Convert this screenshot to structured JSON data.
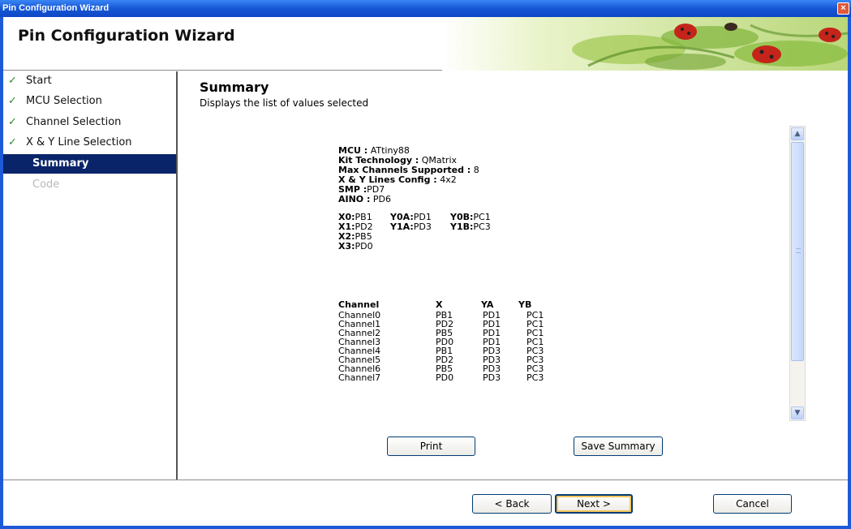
{
  "window": {
    "title": "Pin Configuration Wizard",
    "close_glyph": "×"
  },
  "header": {
    "title": "Pin Configuration Wizard"
  },
  "nav": {
    "items": [
      {
        "label": "Start",
        "state": "done"
      },
      {
        "label": "MCU Selection",
        "state": "done"
      },
      {
        "label": "Channel Selection",
        "state": "done"
      },
      {
        "label": "X & Y Line Selection",
        "state": "done"
      },
      {
        "label": "Summary",
        "state": "active"
      },
      {
        "label": "Code",
        "state": "disabled"
      }
    ],
    "check_glyph": "✓"
  },
  "summary": {
    "title": "Summary",
    "subtitle": "Displays the list of values selected",
    "mcu_label": "MCU :",
    "mcu_value": "ATtiny88",
    "kit_label": "Kit Technology :",
    "kit_value": "QMatrix",
    "max_channels_label": "Max Channels Supported :",
    "max_channels_value": "8",
    "xy_config_label": "X & Y Lines Config :",
    "xy_config_value": "4x2",
    "smp_label": "SMP :",
    "smp_value": "PD7",
    "aino_label": "AINO :",
    "aino_value": "PD6",
    "pin_rows": [
      {
        "x_label": "X0:",
        "x_value": "PB1",
        "ya_label": "Y0A:",
        "ya_value": "PD1",
        "yb_label": "Y0B:",
        "yb_value": "PC1"
      },
      {
        "x_label": "X1:",
        "x_value": "PD2",
        "ya_label": "Y1A:",
        "ya_value": "PD3",
        "yb_label": "Y1B:",
        "yb_value": "PC3"
      },
      {
        "x_label": "X2:",
        "x_value": "PB5"
      },
      {
        "x_label": "X3:",
        "x_value": "PD0"
      }
    ],
    "channel_table": {
      "headers": [
        "Channel",
        "X",
        "YA",
        "YB"
      ],
      "rows": [
        [
          "Channel0",
          "PB1",
          "PD1",
          "PC1"
        ],
        [
          "Channel1",
          "PD2",
          "PD1",
          "PC1"
        ],
        [
          "Channel2",
          "PB5",
          "PD1",
          "PC1"
        ],
        [
          "Channel3",
          "PD0",
          "PD1",
          "PC1"
        ],
        [
          "Channel4",
          "PB1",
          "PD3",
          "PC3"
        ],
        [
          "Channel5",
          "PD2",
          "PD3",
          "PC3"
        ],
        [
          "Channel6",
          "PB5",
          "PD3",
          "PC3"
        ],
        [
          "Channel7",
          "PD0",
          "PD3",
          "PC3"
        ]
      ]
    },
    "print_label": "Print",
    "save_label": "Save Summary"
  },
  "footer": {
    "back_label": "< Back",
    "next_label": "Next >",
    "cancel_label": "Cancel"
  },
  "scroll": {
    "up_glyph": "▲",
    "down_glyph": "▼"
  },
  "colors": {
    "titlebar": "#1657d6",
    "active_nav": "#0a246a",
    "check": "#2f8a2f"
  }
}
